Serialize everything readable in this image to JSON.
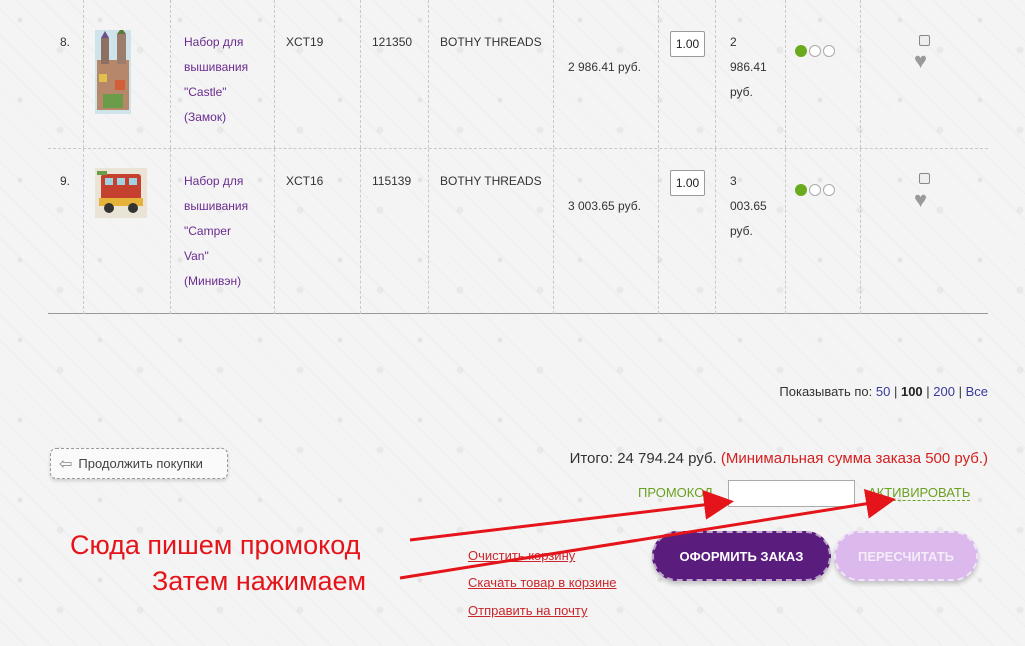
{
  "items": [
    {
      "num": "8.",
      "name_lines": [
        "Набор для",
        "вышивания",
        "\"Castle\"",
        "(Замок)"
      ],
      "sku": "XCT19",
      "code": "121350",
      "brand": "BOTHY THREADS",
      "price": "2 986.41 руб.",
      "qty": "1.00",
      "sum_lines": [
        "2",
        "986.41",
        "руб."
      ],
      "availability": 1,
      "thumb_icon": "castle-thumbnail"
    },
    {
      "num": "9.",
      "name_lines": [
        "Набор для",
        "вышивания",
        "\"Camper",
        "Van\"",
        "(Минивэн)"
      ],
      "sku": "XCT16",
      "code": "115139",
      "brand": "BOTHY THREADS",
      "price": "3 003.65 руб.",
      "qty": "1.00",
      "sum_lines": [
        "3",
        "003.65",
        "руб."
      ],
      "availability": 1,
      "thumb_icon": "camper-van-thumbnail"
    }
  ],
  "pager": {
    "label": "Показывать по:",
    "options": [
      "50",
      "100",
      "200",
      "Все"
    ],
    "active": "100"
  },
  "continue_label": "Продолжить покупки",
  "total": {
    "label": "Итого: 24 794.24 руб.",
    "min_note": "(Минимальная сумма заказа 500 руб.)"
  },
  "promo": {
    "label": "ПРОМОКОД",
    "value": "",
    "activate_label": "АКТИВИРОВАТЬ"
  },
  "links": {
    "clear": "Очистить корзину",
    "download": "Скачать товар в корзине",
    "email": "Отправить на почту"
  },
  "buttons": {
    "order": "ОФОРМИТЬ ЗАКАЗ",
    "recalc": "ПЕРЕСЧИТАТЬ"
  },
  "annotations": {
    "line1": "Сюда пишем промокод",
    "line2": "Затем нажимаем"
  },
  "colors": {
    "accent_purple": "#5a1d7e",
    "light_purple": "#dcb9ec",
    "promo_green": "#6aa121",
    "annotation_red": "#e4141a",
    "availability_green": "#6aaa1e"
  }
}
